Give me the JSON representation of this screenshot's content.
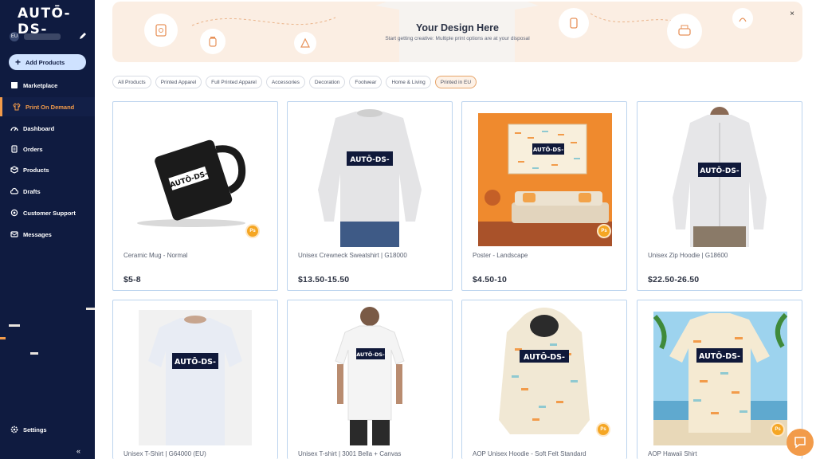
{
  "brand": {
    "logo_text": "AUTŌ-DS-"
  },
  "user": {
    "badge": "EU"
  },
  "sidebar": {
    "add_products": "Add Products",
    "items": [
      {
        "label": "Marketplace",
        "icon": "store-icon"
      },
      {
        "label": "Print On Demand",
        "icon": "shirt-icon",
        "active": true
      },
      {
        "label": "Dashboard",
        "icon": "gauge-icon"
      },
      {
        "label": "Orders",
        "icon": "document-icon"
      },
      {
        "label": "Products",
        "icon": "box-icon"
      },
      {
        "label": "Drafts",
        "icon": "cloud-icon"
      },
      {
        "label": "Customer Support",
        "icon": "support-icon"
      },
      {
        "label": "Messages",
        "icon": "mail-icon"
      }
    ],
    "settings": "Settings",
    "collapse": "«"
  },
  "banner": {
    "title": "Your Design Here",
    "subtitle": "Start getting creative: Multiple print options are at your disposal",
    "close": "×"
  },
  "filters": [
    "All Products",
    "Printed Apparel",
    "Full Printed Apparel",
    "Accessories",
    "Decoration",
    "Footwear",
    "Home & Living",
    "Printed in EU"
  ],
  "active_filter": "Printed in EU",
  "products": [
    {
      "name": "Ceramic Mug - Normal",
      "price": "$5-8",
      "badge": "Ps"
    },
    {
      "name": "Unisex Crewneck Sweatshirt | G18000",
      "price": "$13.50-15.50",
      "badge": ""
    },
    {
      "name": "Poster - Landscape",
      "price": "$4.50-10",
      "badge": "Ps"
    },
    {
      "name": "Unisex Zip Hoodie | G18600",
      "price": "$22.50-26.50",
      "badge": ""
    },
    {
      "name": "Unisex T-Shirt | G64000 (EU)",
      "price": "",
      "badge": ""
    },
    {
      "name": "Unisex T-shirt | 3001 Bella + Canvas",
      "price": "",
      "badge": ""
    },
    {
      "name": "AOP Unisex Hoodie - Soft Felt Standard",
      "price": "",
      "badge": "Ps"
    },
    {
      "name": "AOP Hawaii Shirt",
      "price": "",
      "badge": "Ps"
    }
  ],
  "print_label": "AUTŌ-DS-",
  "colors": {
    "sidebar": "#0f1b40",
    "accent": "#f29b4a",
    "card_border": "#bcd4ee",
    "banner": "#fbeee3"
  }
}
